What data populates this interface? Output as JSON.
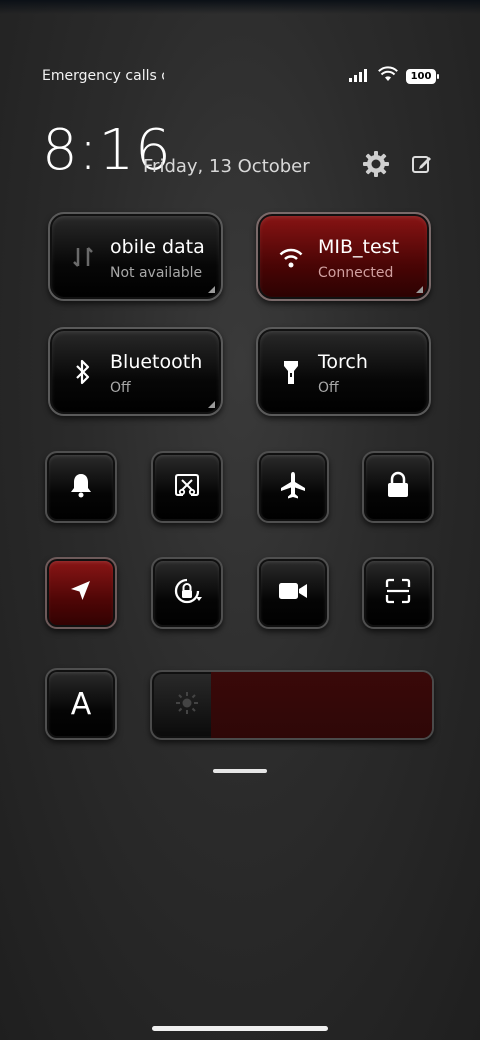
{
  "status_bar": {
    "carrier_text": "Emergency calls o",
    "battery": "100"
  },
  "header": {
    "time": "8:16",
    "date": "Friday, 13 October"
  },
  "tiles": [
    {
      "title": "obile data",
      "subtitle": "Not available",
      "active": false,
      "icon": "mobile-data-icon"
    },
    {
      "title": "MIB_test",
      "subtitle": "Connected",
      "active": true,
      "icon": "wifi-icon"
    },
    {
      "title": "Bluetooth",
      "subtitle": "Off",
      "active": false,
      "icon": "bluetooth-icon"
    },
    {
      "title": "Torch",
      "subtitle": "Off",
      "active": false,
      "icon": "torch-icon"
    }
  ],
  "toggles_row1": [
    "bell-icon",
    "screenshot-icon",
    "airplane-icon",
    "lock-icon"
  ],
  "toggles_row2": [
    "location-icon",
    "rotation-lock-icon",
    "video-camera-icon",
    "scan-icon"
  ],
  "auto_brightness_label": "A",
  "brightness": {
    "level": 0.21
  },
  "colors": {
    "accent_red": "#8a1414",
    "tile_dark": "#070707"
  }
}
